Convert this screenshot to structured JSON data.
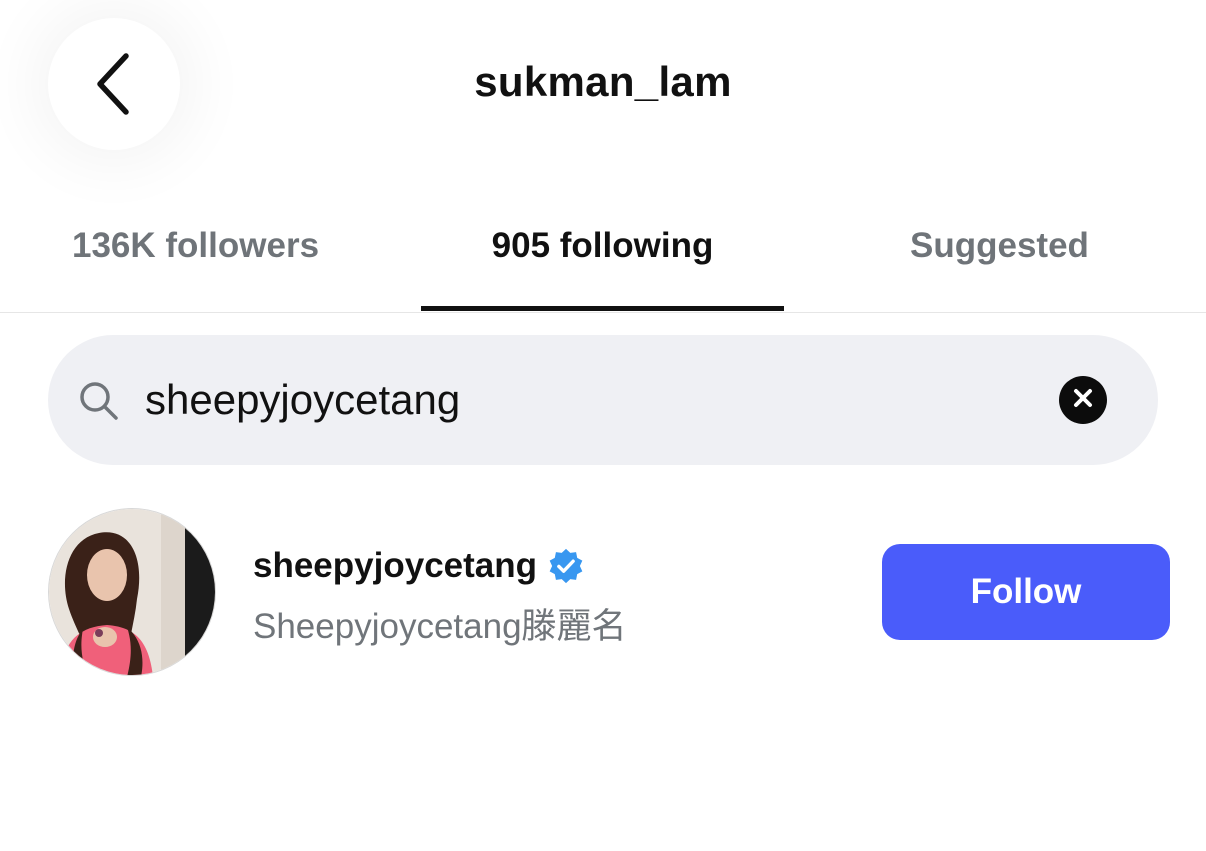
{
  "header": {
    "title": "sukman_lam",
    "back_icon": "chevron-left-icon"
  },
  "tabs": [
    {
      "label": "136K followers",
      "active": false
    },
    {
      "label": "905 following",
      "active": true
    },
    {
      "label": "Suggested",
      "active": false
    }
  ],
  "search": {
    "value": "sheepyjoycetang",
    "icon": "search-icon",
    "clear_icon": "close-circle-icon"
  },
  "results": [
    {
      "username": "sheepyjoycetang",
      "verified": true,
      "full_name": "Sheepyjoycetang滕麗名",
      "button_label": "Follow"
    }
  ],
  "colors": {
    "accent": "#4a5cfa",
    "verified": "#3897f0",
    "search_bg": "#eff0f4",
    "muted_text": "#70757a"
  }
}
